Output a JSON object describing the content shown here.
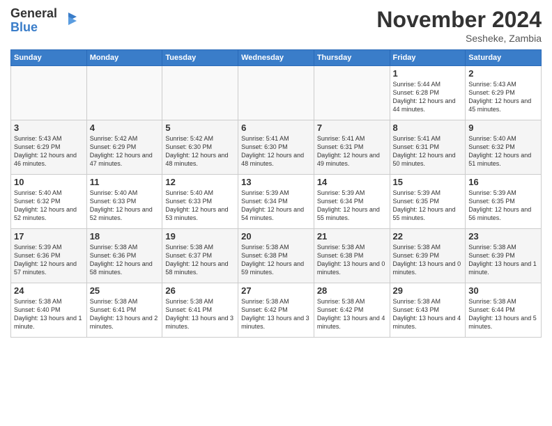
{
  "logo": {
    "general": "General",
    "blue": "Blue"
  },
  "title": "November 2024",
  "location": "Sesheke, Zambia",
  "days_header": [
    "Sunday",
    "Monday",
    "Tuesday",
    "Wednesday",
    "Thursday",
    "Friday",
    "Saturday"
  ],
  "weeks": [
    [
      {
        "day": "",
        "info": ""
      },
      {
        "day": "",
        "info": ""
      },
      {
        "day": "",
        "info": ""
      },
      {
        "day": "",
        "info": ""
      },
      {
        "day": "",
        "info": ""
      },
      {
        "day": "1",
        "info": "Sunrise: 5:44 AM\nSunset: 6:28 PM\nDaylight: 12 hours\nand 44 minutes."
      },
      {
        "day": "2",
        "info": "Sunrise: 5:43 AM\nSunset: 6:29 PM\nDaylight: 12 hours\nand 45 minutes."
      }
    ],
    [
      {
        "day": "3",
        "info": "Sunrise: 5:43 AM\nSunset: 6:29 PM\nDaylight: 12 hours\nand 46 minutes."
      },
      {
        "day": "4",
        "info": "Sunrise: 5:42 AM\nSunset: 6:29 PM\nDaylight: 12 hours\nand 47 minutes."
      },
      {
        "day": "5",
        "info": "Sunrise: 5:42 AM\nSunset: 6:30 PM\nDaylight: 12 hours\nand 48 minutes."
      },
      {
        "day": "6",
        "info": "Sunrise: 5:41 AM\nSunset: 6:30 PM\nDaylight: 12 hours\nand 48 minutes."
      },
      {
        "day": "7",
        "info": "Sunrise: 5:41 AM\nSunset: 6:31 PM\nDaylight: 12 hours\nand 49 minutes."
      },
      {
        "day": "8",
        "info": "Sunrise: 5:41 AM\nSunset: 6:31 PM\nDaylight: 12 hours\nand 50 minutes."
      },
      {
        "day": "9",
        "info": "Sunrise: 5:40 AM\nSunset: 6:32 PM\nDaylight: 12 hours\nand 51 minutes."
      }
    ],
    [
      {
        "day": "10",
        "info": "Sunrise: 5:40 AM\nSunset: 6:32 PM\nDaylight: 12 hours\nand 52 minutes."
      },
      {
        "day": "11",
        "info": "Sunrise: 5:40 AM\nSunset: 6:33 PM\nDaylight: 12 hours\nand 52 minutes."
      },
      {
        "day": "12",
        "info": "Sunrise: 5:40 AM\nSunset: 6:33 PM\nDaylight: 12 hours\nand 53 minutes."
      },
      {
        "day": "13",
        "info": "Sunrise: 5:39 AM\nSunset: 6:34 PM\nDaylight: 12 hours\nand 54 minutes."
      },
      {
        "day": "14",
        "info": "Sunrise: 5:39 AM\nSunset: 6:34 PM\nDaylight: 12 hours\nand 55 minutes."
      },
      {
        "day": "15",
        "info": "Sunrise: 5:39 AM\nSunset: 6:35 PM\nDaylight: 12 hours\nand 55 minutes."
      },
      {
        "day": "16",
        "info": "Sunrise: 5:39 AM\nSunset: 6:35 PM\nDaylight: 12 hours\nand 56 minutes."
      }
    ],
    [
      {
        "day": "17",
        "info": "Sunrise: 5:39 AM\nSunset: 6:36 PM\nDaylight: 12 hours\nand 57 minutes."
      },
      {
        "day": "18",
        "info": "Sunrise: 5:38 AM\nSunset: 6:36 PM\nDaylight: 12 hours\nand 58 minutes."
      },
      {
        "day": "19",
        "info": "Sunrise: 5:38 AM\nSunset: 6:37 PM\nDaylight: 12 hours\nand 58 minutes."
      },
      {
        "day": "20",
        "info": "Sunrise: 5:38 AM\nSunset: 6:38 PM\nDaylight: 12 hours\nand 59 minutes."
      },
      {
        "day": "21",
        "info": "Sunrise: 5:38 AM\nSunset: 6:38 PM\nDaylight: 13 hours\nand 0 minutes."
      },
      {
        "day": "22",
        "info": "Sunrise: 5:38 AM\nSunset: 6:39 PM\nDaylight: 13 hours\nand 0 minutes."
      },
      {
        "day": "23",
        "info": "Sunrise: 5:38 AM\nSunset: 6:39 PM\nDaylight: 13 hours\nand 1 minute."
      }
    ],
    [
      {
        "day": "24",
        "info": "Sunrise: 5:38 AM\nSunset: 6:40 PM\nDaylight: 13 hours\nand 1 minute."
      },
      {
        "day": "25",
        "info": "Sunrise: 5:38 AM\nSunset: 6:41 PM\nDaylight: 13 hours\nand 2 minutes."
      },
      {
        "day": "26",
        "info": "Sunrise: 5:38 AM\nSunset: 6:41 PM\nDaylight: 13 hours\nand 3 minutes."
      },
      {
        "day": "27",
        "info": "Sunrise: 5:38 AM\nSunset: 6:42 PM\nDaylight: 13 hours\nand 3 minutes."
      },
      {
        "day": "28",
        "info": "Sunrise: 5:38 AM\nSunset: 6:42 PM\nDaylight: 13 hours\nand 4 minutes."
      },
      {
        "day": "29",
        "info": "Sunrise: 5:38 AM\nSunset: 6:43 PM\nDaylight: 13 hours\nand 4 minutes."
      },
      {
        "day": "30",
        "info": "Sunrise: 5:38 AM\nSunset: 6:44 PM\nDaylight: 13 hours\nand 5 minutes."
      }
    ]
  ]
}
